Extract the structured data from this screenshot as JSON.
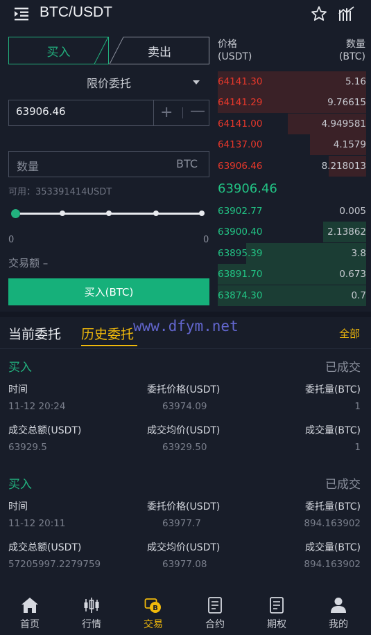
{
  "header": {
    "title": "BTC/USDT",
    "menu_icon": "menu-icon",
    "favorite_icon": "star-icon",
    "chart_icon": "kline-chart-icon"
  },
  "trade": {
    "buy_tab": "买入",
    "sell_tab": "卖出",
    "order_type": "限价委托",
    "price_value": "63906.46",
    "plus": "+",
    "minus": "—",
    "quantity_placeholder": "数量",
    "quantity_unit": "BTC",
    "available": "可用：353391414USDT",
    "slider_min": "0",
    "slider_max": "0",
    "slider_percent": 0,
    "amount_label": "交易额 –",
    "submit_label": "买入(BTC)"
  },
  "orderbook": {
    "price_header": "价格",
    "price_unit": "(USDT)",
    "qty_header": "数量",
    "qty_unit": "(BTC)",
    "asks": [
      {
        "price": "64141.30",
        "qty": "5.16",
        "depth": 1.0
      },
      {
        "price": "64141.29",
        "qty": "9.76615",
        "depth": 1.0
      },
      {
        "price": "64141.00",
        "qty": "4.949581",
        "depth": 0.53
      },
      {
        "price": "64137.00",
        "qty": "4.1579",
        "depth": 0.38
      },
      {
        "price": "63906.46",
        "qty": "8.218013",
        "depth": 0.25
      }
    ],
    "last_price": "63906.46",
    "bids": [
      {
        "price": "63902.77",
        "qty": "0.005",
        "depth": 0.0
      },
      {
        "price": "63900.40",
        "qty": "2.13862",
        "depth": 0.29
      },
      {
        "price": "63895.39",
        "qty": "3.8",
        "depth": 0.81
      },
      {
        "price": "63891.70",
        "qty": "0.673",
        "depth": 1.0
      },
      {
        "price": "63874.30",
        "qty": "0.7",
        "depth": 1.0
      }
    ],
    "colors": {
      "ask": "#e9382b",
      "bid": "#22c485",
      "ask_bar": "#3a2127",
      "bid_bar": "#1b3d34"
    }
  },
  "orders": {
    "tab_current": "当前委托",
    "tab_history": "历史委托",
    "view_all": "全部",
    "watermark": "www.dfym.net",
    "items": [
      {
        "side": "买入",
        "status": "已成交",
        "l_time": "时间",
        "l_price": "委托价格(USDT)",
        "l_amount": "委托量(BTC)",
        "time": "11-12 20:24",
        "price": "63974.09",
        "amount": "1",
        "l_total": "成交总额(USDT)",
        "l_avg": "成交均价(USDT)",
        "l_filled": "成交量(BTC)",
        "total": "63929.5",
        "avg": "63929.50",
        "filled": "1"
      },
      {
        "side": "买入",
        "status": "已成交",
        "l_time": "时间",
        "l_price": "委托价格(USDT)",
        "l_amount": "委托量(BTC)",
        "time": "11-12 20:11",
        "price": "63977.7",
        "amount": "894.163902",
        "l_total": "成交总额(USDT)",
        "l_avg": "成交均价(USDT)",
        "l_filled": "成交量(BTC)",
        "total": "57205997.2279759",
        "avg": "63977.08",
        "filled": "894.163902"
      }
    ]
  },
  "nav": {
    "items": [
      {
        "label": "首页",
        "icon": "home-icon"
      },
      {
        "label": "行情",
        "icon": "candlestick-icon"
      },
      {
        "label": "交易",
        "icon": "trade-coin-icon",
        "active": true
      },
      {
        "label": "合约",
        "icon": "contract-icon"
      },
      {
        "label": "期权",
        "icon": "options-icon"
      },
      {
        "label": "我的",
        "icon": "profile-icon"
      }
    ]
  }
}
